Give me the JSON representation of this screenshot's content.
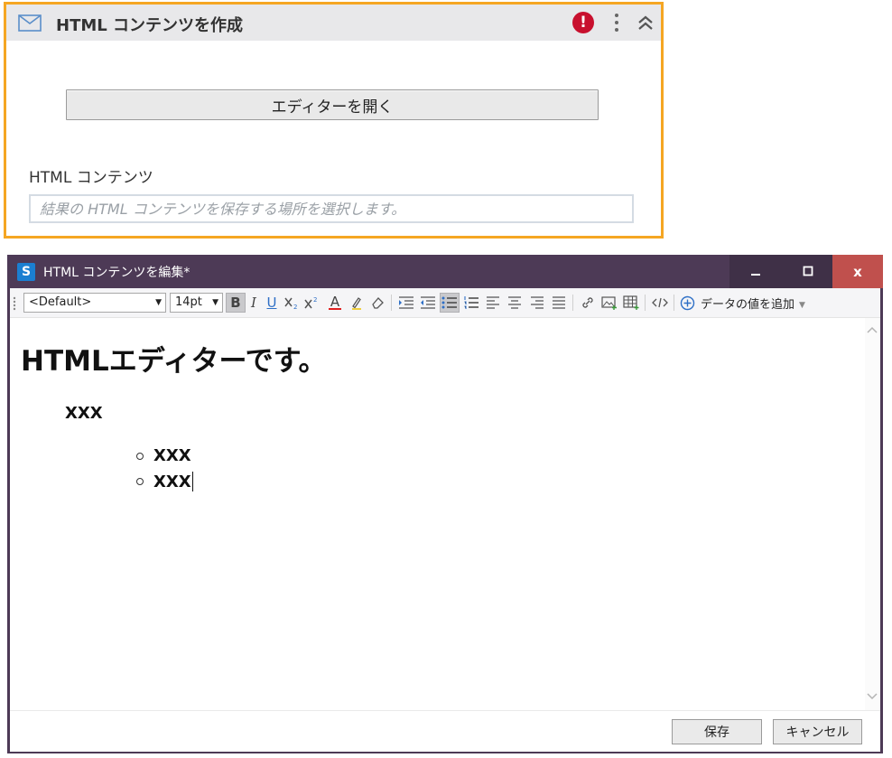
{
  "activity": {
    "title": "HTML コンテンツを作成",
    "open_editor_label": "エディターを開く",
    "html_content_label": "HTML コンテンツ",
    "html_content_placeholder": "結果の HTML コンテンツを保存する場所を選択します。",
    "error_glyph": "!",
    "accent_color": "#f5a623"
  },
  "editor_window": {
    "title": "HTML コンテンツを編集*",
    "app_icon_glyph": "S",
    "controls": {
      "minimize": "–",
      "maximize": "□",
      "close": "x"
    },
    "toolbar": {
      "font_family": "<Default>",
      "font_size": "14pt",
      "buttons": [
        "bold",
        "italic",
        "underline",
        "subscript",
        "superscript",
        "font-color",
        "highlight",
        "eraser",
        "indent",
        "outdent",
        "bullet-list",
        "numbered-list",
        "align-left",
        "align-center",
        "align-right",
        "justify",
        "link",
        "image",
        "table",
        "source"
      ],
      "icon_glyphs": {
        "bold": "B",
        "italic": "I",
        "underline": "U",
        "font_color": "A"
      },
      "add_data_label": "データの値を追加"
    },
    "content": {
      "heading": "HTMLエディターです。",
      "paragraph": "XXX",
      "list_items": [
        "XXX",
        "XXX"
      ]
    },
    "footer": {
      "save_label": "保存",
      "cancel_label": "キャンセル"
    },
    "title_bar_color": "#4d3a56",
    "close_color": "#c0504d"
  }
}
